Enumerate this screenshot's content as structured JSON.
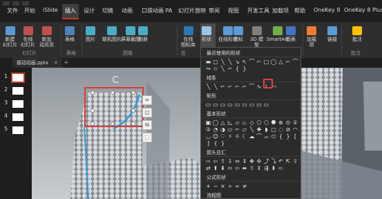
{
  "menu": {
    "tabs": [
      {
        "label": "文件"
      },
      {
        "label": "开始"
      },
      {
        "label": "iSlide"
      },
      {
        "label": "插入",
        "active": true
      },
      {
        "label": "设计"
      },
      {
        "label": "切换"
      },
      {
        "label": "动画"
      },
      {
        "label": "口袋动画 PA"
      },
      {
        "label": "幻灯片放映"
      },
      {
        "label": "审阅"
      },
      {
        "label": "视图"
      },
      {
        "label": "开发工具"
      },
      {
        "label": "加载项"
      },
      {
        "label": "帮助"
      },
      {
        "label": "OneKey 8"
      },
      {
        "label": "OneKey 8 Plus"
      }
    ]
  },
  "ribbon": {
    "buttons": [
      {
        "label": "新建\n幻灯片",
        "icon": "new-slide-icon",
        "color": "#5b9bd5"
      },
      {
        "label": "在线\n幻灯片",
        "icon": "online-slide-icon",
        "color": "#c0504d"
      },
      {
        "label": "新加\n动页页",
        "icon": "new-page-icon",
        "color": "#c0504d"
      },
      {
        "label": "表格",
        "icon": "table-icon",
        "color": "#4f81bd"
      },
      {
        "label": "图片",
        "icon": "picture-icon",
        "color": "#4bacc6"
      },
      {
        "label": "联机图片",
        "icon": "online-picture-icon",
        "color": "#4bacc6"
      },
      {
        "label": "屏幕截图",
        "icon": "screenshot-icon",
        "color": "#4bacc6"
      },
      {
        "label": "相册",
        "icon": "album-icon",
        "color": "#4bacc6"
      },
      {
        "label": "在线\n图标库",
        "icon": "icon-library-icon",
        "color": "#2e75b6"
      },
      {
        "label": "形状",
        "icon": "shapes-icon",
        "color": "#9dc3e6"
      },
      {
        "label": "在线形状",
        "icon": "online-shapes-icon",
        "color": "#5b9bd5"
      },
      {
        "label": "图标",
        "icon": "icons-icon",
        "color": "#5b9bd5"
      },
      {
        "label": "3D 模\n型",
        "icon": "3d-model-icon",
        "color": "#7f7f7f"
      },
      {
        "label": "SmartArt",
        "icon": "smartart-icon",
        "color": "#70ad47"
      },
      {
        "label": "图表",
        "icon": "chart-icon",
        "color": "#4472c4"
      },
      {
        "label": "加载\n项",
        "icon": "addin-icon",
        "color": "#ed7d31"
      },
      {
        "label": "链接",
        "icon": "link-icon",
        "color": "#5b9bd5"
      },
      {
        "label": "批注",
        "icon": "comment-icon",
        "color": "#ffc000"
      }
    ],
    "groups": [
      {
        "label": "幻灯片"
      },
      {
        "label": "表格"
      },
      {
        "label": "图像"
      },
      {
        "label": "在"
      },
      {
        "label": "批注"
      }
    ]
  },
  "file_tab": {
    "name": "振动动画.pptx",
    "close": "✕",
    "add": "+"
  },
  "thumbnails": [
    {
      "number": "1",
      "selected": true
    },
    {
      "number": "2",
      "selected": false
    },
    {
      "number": "3",
      "selected": false
    },
    {
      "number": "4",
      "selected": false
    },
    {
      "number": "5",
      "selected": false
    }
  ],
  "shapes_gallery": {
    "sections": [
      {
        "title": "最近使用的形状",
        "glyphs": [
          "▬",
          "▢",
          "╲",
          "╲",
          "↘",
          "↖",
          "⌒",
          "⌐",
          "□",
          "◯",
          "△",
          "⌐",
          "⌒",
          "↪",
          "☆",
          "╲",
          "⌐",
          "{",
          "}"
        ]
      },
      {
        "title": "线条",
        "glyphs": [
          "╲",
          "╲",
          "⌐",
          "⌐",
          "⌐",
          "⌐",
          "⌒",
          "∿",
          "⌇",
          "⤺"
        ]
      },
      {
        "title": "矩形",
        "glyphs": [
          "▭",
          "▭",
          "▭",
          "▭",
          "▭",
          "▭",
          "▭",
          "▭",
          "▭"
        ]
      },
      {
        "title": "基本形状",
        "glyphs": [
          "▣",
          "◯",
          "△",
          "◺",
          "▱",
          "⏢",
          "◇",
          "⬠",
          "⬡",
          "⯃",
          "⊛",
          "⊙",
          "①",
          "②",
          "◔",
          "◑",
          "▭",
          "⌐",
          "▱",
          "╲",
          "✚",
          "◗",
          "▢",
          "◌",
          "⊘",
          "◠",
          "◡",
          "☺",
          "♡",
          "⚡",
          "☼",
          "☾",
          "☁",
          "⌒",
          "⌓",
          "⬭",
          "{",
          "}",
          "[",
          "]",
          "{",
          "}"
        ]
      },
      {
        "title": "箭头总汇",
        "glyphs": [
          "⇨",
          "⇦",
          "⇧",
          "⇩",
          "⇔",
          "⇕",
          "✥",
          "✣",
          "⤴",
          "⤵",
          "↶",
          "⇱",
          "⇪",
          "⇄",
          "⬆",
          "⬇",
          "⇰",
          "⇦",
          "⬌",
          "⇧",
          "⇕",
          "⇶",
          "⬍",
          "⇦"
        ]
      },
      {
        "title": "公式形状",
        "glyphs": [
          "+",
          "−",
          "×",
          "÷",
          "=",
          "≠"
        ]
      },
      {
        "title": "流程图",
        "glyphs": []
      }
    ]
  },
  "colors": {
    "accent": "#c43e1c",
    "highlight": "#e04040",
    "selection_stroke": "#2b9bd8"
  }
}
